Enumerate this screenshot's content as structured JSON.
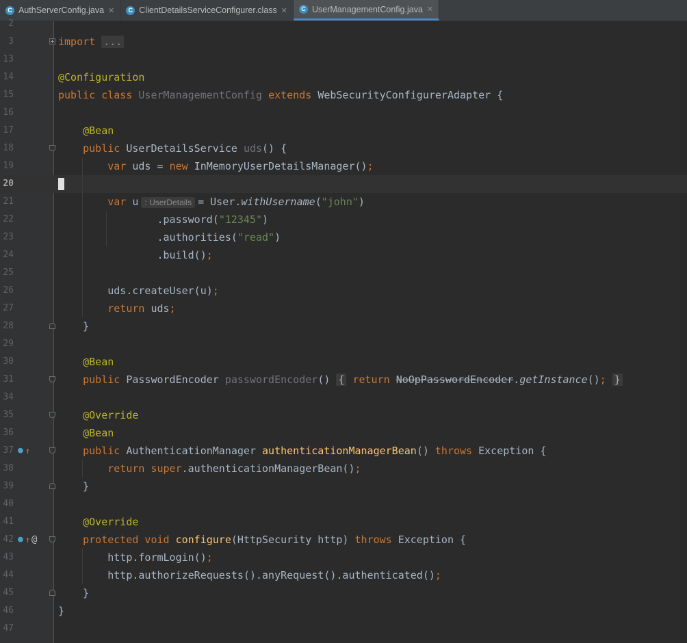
{
  "tabs": [
    {
      "label": "AuthServerConfig.java",
      "icon": "c",
      "active": false
    },
    {
      "label": "ClientDetailsServiceConfigurer.class",
      "icon": "c",
      "active": false
    },
    {
      "label": "UserManagementConfig.java",
      "icon": "c",
      "active": true
    }
  ],
  "icon_text": "C",
  "close_glyph": "✕",
  "gutter_glyphs": {
    "override": "●",
    "up": "↑",
    "at": "@"
  },
  "editor": {
    "current_line": 20,
    "lines": [
      {
        "n": "2"
      },
      {
        "n": "3",
        "parts": [
          [
            "kw",
            "import "
          ],
          [
            "fold",
            "..."
          ]
        ]
      },
      {
        "n": "13"
      },
      {
        "n": "14",
        "parts": [
          [
            "ann",
            "@Configuration"
          ]
        ]
      },
      {
        "n": "15",
        "parts": [
          [
            "kw",
            "public class "
          ],
          [
            "unused",
            "UserManagementConfig "
          ],
          [
            "kw",
            "extends "
          ],
          [
            "plain",
            "WebSecurityConfigurerAdapter {"
          ]
        ]
      },
      {
        "n": "16"
      },
      {
        "n": "17",
        "parts": [
          [
            "plain",
            "    "
          ],
          [
            "ann",
            "@Bean"
          ]
        ]
      },
      {
        "n": "18",
        "parts": [
          [
            "plain",
            "    "
          ],
          [
            "kw",
            "public "
          ],
          [
            "plain",
            "UserDetailsService "
          ],
          [
            "unused",
            "uds"
          ],
          [
            "plain",
            "() {"
          ]
        ]
      },
      {
        "n": "19",
        "parts": [
          [
            "plain",
            "        "
          ],
          [
            "kw",
            "var "
          ],
          [
            "plain",
            "uds = "
          ],
          [
            "kw",
            "new "
          ],
          [
            "plain",
            "InMemoryUserDetailsManager()"
          ],
          [
            "kw",
            ";"
          ]
        ]
      },
      {
        "n": "20"
      },
      {
        "n": "21",
        "parts": [
          [
            "plain",
            "        "
          ],
          [
            "kw",
            "var "
          ],
          [
            "plain",
            "u"
          ],
          [
            "hint",
            ": UserDetails"
          ],
          [
            "plain",
            "= User."
          ],
          [
            "it",
            "withUsername"
          ],
          [
            "plain",
            "("
          ],
          [
            "str",
            "\"john\""
          ],
          [
            "plain",
            ")"
          ]
        ]
      },
      {
        "n": "22",
        "parts": [
          [
            "plain",
            "                ."
          ],
          [
            "plain",
            "password("
          ],
          [
            "str",
            "\"12345\""
          ],
          [
            "plain",
            ")"
          ]
        ]
      },
      {
        "n": "23",
        "parts": [
          [
            "plain",
            "                ."
          ],
          [
            "plain",
            "authorities("
          ],
          [
            "str",
            "\"read\""
          ],
          [
            "plain",
            ")"
          ]
        ]
      },
      {
        "n": "24",
        "parts": [
          [
            "plain",
            "                .build()"
          ],
          [
            "kw",
            ";"
          ]
        ]
      },
      {
        "n": "25"
      },
      {
        "n": "26",
        "parts": [
          [
            "plain",
            "        uds.createUser(u)"
          ],
          [
            "kw",
            ";"
          ]
        ]
      },
      {
        "n": "27",
        "parts": [
          [
            "plain",
            "        "
          ],
          [
            "kw",
            "return "
          ],
          [
            "plain",
            "uds"
          ],
          [
            "kw",
            ";"
          ]
        ]
      },
      {
        "n": "28",
        "parts": [
          [
            "plain",
            "    }"
          ]
        ]
      },
      {
        "n": "29"
      },
      {
        "n": "30",
        "parts": [
          [
            "plain",
            "    "
          ],
          [
            "ann",
            "@Bean"
          ]
        ]
      },
      {
        "n": "31",
        "parts": [
          [
            "plain",
            "    "
          ],
          [
            "kw",
            "public "
          ],
          [
            "plain",
            "PasswordEncoder "
          ],
          [
            "unused",
            "passwordEncoder"
          ],
          [
            "plain",
            "() "
          ],
          [
            "box",
            "{"
          ],
          [
            "plain",
            " "
          ],
          [
            "kw",
            "return "
          ],
          [
            "strike",
            "NoOpPasswordEncoder"
          ],
          [
            "plain",
            "."
          ],
          [
            "it",
            "getInstance"
          ],
          [
            "plain",
            "()"
          ],
          [
            "kw",
            ";"
          ],
          [
            "plain",
            " "
          ],
          [
            "box",
            "}"
          ]
        ]
      },
      {
        "n": "34"
      },
      {
        "n": "35",
        "parts": [
          [
            "plain",
            "    "
          ],
          [
            "ann",
            "@Override"
          ]
        ]
      },
      {
        "n": "36",
        "parts": [
          [
            "plain",
            "    "
          ],
          [
            "ann",
            "@Bean"
          ]
        ]
      },
      {
        "n": "37",
        "parts": [
          [
            "plain",
            "    "
          ],
          [
            "kw",
            "public "
          ],
          [
            "plain",
            "AuthenticationManager "
          ],
          [
            "fn",
            "authenticationManagerBean"
          ],
          [
            "plain",
            "() "
          ],
          [
            "kw",
            "throws "
          ],
          [
            "plain",
            "Exception {"
          ]
        ]
      },
      {
        "n": "38",
        "parts": [
          [
            "plain",
            "        "
          ],
          [
            "kw",
            "return super"
          ],
          [
            "plain",
            ".authenticationManagerBean()"
          ],
          [
            "kw",
            ";"
          ]
        ]
      },
      {
        "n": "39",
        "parts": [
          [
            "plain",
            "    }"
          ]
        ]
      },
      {
        "n": "40"
      },
      {
        "n": "41",
        "parts": [
          [
            "plain",
            "    "
          ],
          [
            "ann",
            "@Override"
          ]
        ]
      },
      {
        "n": "42",
        "parts": [
          [
            "plain",
            "    "
          ],
          [
            "kw",
            "protected void "
          ],
          [
            "fn",
            "configure"
          ],
          [
            "plain",
            "(HttpSecurity http) "
          ],
          [
            "kw",
            "throws "
          ],
          [
            "plain",
            "Exception {"
          ]
        ]
      },
      {
        "n": "43",
        "parts": [
          [
            "plain",
            "        http.formLogin()"
          ],
          [
            "kw",
            ";"
          ]
        ]
      },
      {
        "n": "44",
        "parts": [
          [
            "plain",
            "        http.authorizeRequests().anyRequest().authenticated()"
          ],
          [
            "kw",
            ";"
          ]
        ]
      },
      {
        "n": "45",
        "parts": [
          [
            "plain",
            "    }"
          ]
        ]
      },
      {
        "n": "46",
        "parts": [
          [
            "plain",
            "}"
          ]
        ]
      },
      {
        "n": "47"
      }
    ]
  }
}
